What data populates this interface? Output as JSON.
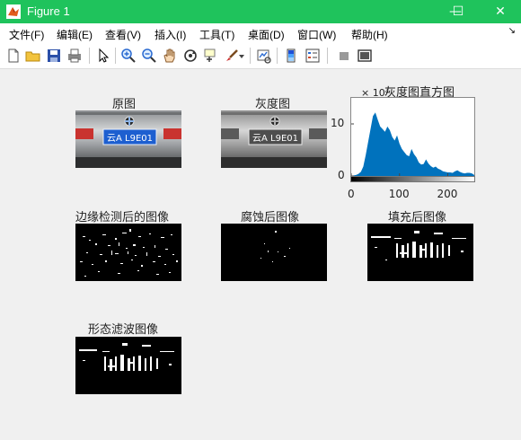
{
  "window": {
    "title": "Figure 1",
    "minimize": "—",
    "maximize": "☐",
    "close": "✕"
  },
  "menu": [
    "文件(F)",
    "编辑(E)",
    "查看(V)",
    "插入(I)",
    "工具(T)",
    "桌面(D)",
    "窗口(W)",
    "帮助(H)"
  ],
  "menu_collapse": "↘",
  "toolbar_icons": [
    "new-figure-icon",
    "open-file-icon",
    "save-icon",
    "print-icon",
    "pointer-icon",
    "zoom-in-icon",
    "zoom-out-icon",
    "pan-icon",
    "rotate-3d-icon",
    "data-cursor-icon",
    "brush-icon",
    "brush-dropdown-icon",
    "link-plot-icon",
    "insert-colorbar-icon",
    "insert-legend-icon",
    "hide-plot-tools-icon",
    "show-plot-tools-icon"
  ],
  "plate_text": "云A L9E01",
  "subplots": {
    "original": "原图",
    "gray": "灰度图",
    "histogram": "灰度图直方图",
    "edges": "边缘检测后的图像",
    "eroded": "腐蚀后图像",
    "filled": "填充后图像",
    "morph": "形态滤波图像"
  },
  "chart_data": {
    "type": "area",
    "title": "灰度图直方图",
    "multiplier": "× 10⁴",
    "x": [
      0,
      5,
      10,
      15,
      20,
      25,
      30,
      35,
      40,
      45,
      50,
      55,
      60,
      65,
      70,
      75,
      80,
      85,
      90,
      95,
      100,
      105,
      110,
      115,
      120,
      125,
      130,
      135,
      140,
      145,
      150,
      155,
      160,
      165,
      170,
      175,
      180,
      185,
      190,
      195,
      200,
      205,
      210,
      215,
      220,
      225,
      230,
      235,
      240,
      245,
      250,
      255
    ],
    "values": [
      0.0,
      0.1,
      0.2,
      0.4,
      0.8,
      1.8,
      4.0,
      6.5,
      9.0,
      11.5,
      12.2,
      10.8,
      9.5,
      9.0,
      8.5,
      9.5,
      8.8,
      7.5,
      6.8,
      7.8,
      6.2,
      5.2,
      4.6,
      4.0,
      3.8,
      5.2,
      4.2,
      3.6,
      2.6,
      2.2,
      2.3,
      3.2,
      2.4,
      1.9,
      1.6,
      1.8,
      1.4,
      1.2,
      0.9,
      0.8,
      0.7,
      0.7,
      0.6,
      0.9,
      1.1,
      0.8,
      0.6,
      0.5,
      0.6,
      0.6,
      0.5,
      0.2
    ],
    "xlim": [
      0,
      255
    ],
    "ylim": [
      0,
      15
    ],
    "xticks": [
      "0",
      "100",
      "200"
    ],
    "xtick_values": [
      0,
      100,
      200
    ],
    "yticks": [
      "0",
      "10"
    ],
    "ytick_values": [
      0,
      10
    ],
    "fill_color": "#0072bd"
  },
  "colors": {
    "titlebar": "#1fc35c",
    "plate_blue": "#1d5fd0"
  }
}
